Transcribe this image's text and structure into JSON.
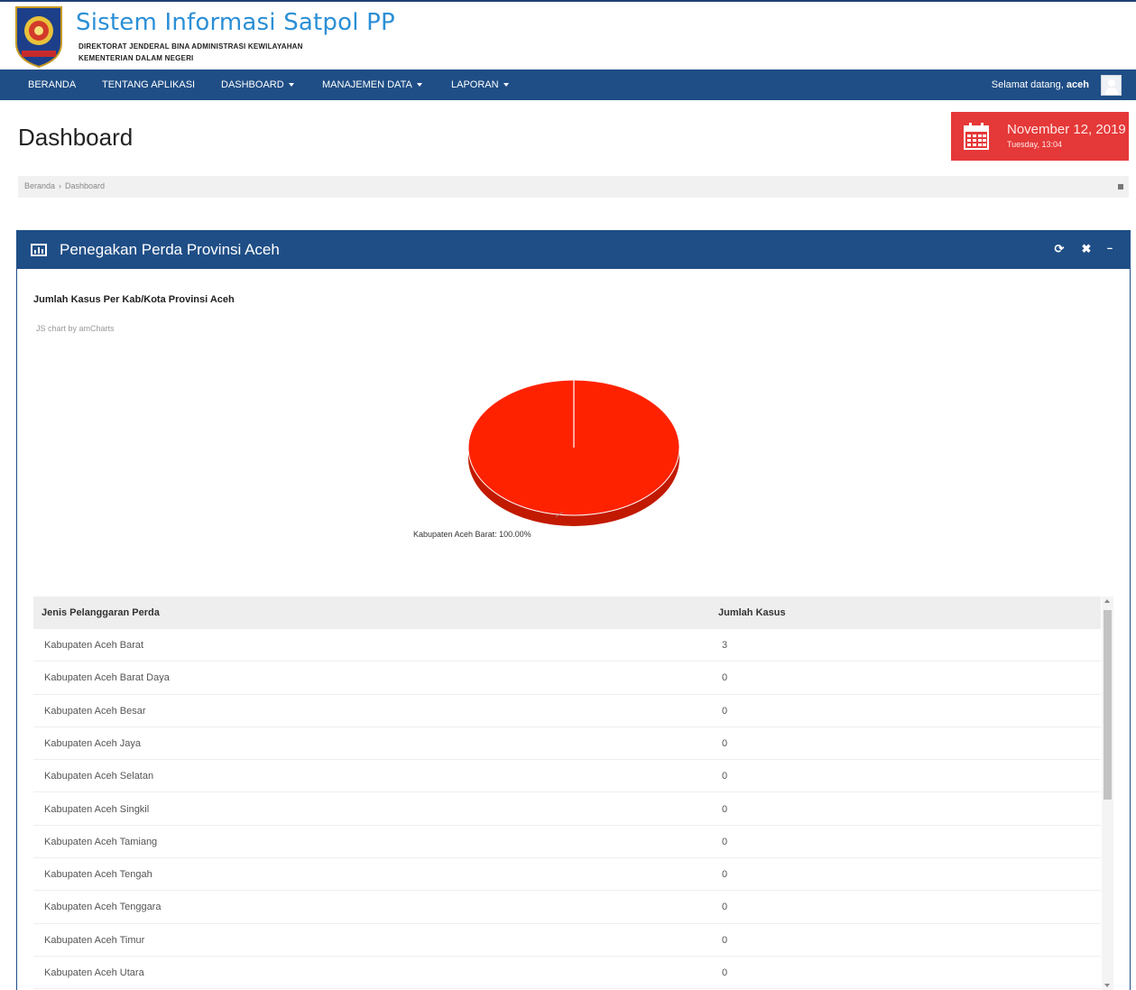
{
  "header": {
    "title": "Sistem Informasi Satpol PP",
    "subtitle_line1": "DIREKTORAT JENDERAL BINA ADMINISTRASI KEWILAYAHAN",
    "subtitle_line2": "KEMENTERIAN DALAM NEGERI"
  },
  "nav": {
    "items": [
      {
        "label": "BERANDA",
        "dropdown": false
      },
      {
        "label": "TENTANG APLIKASI",
        "dropdown": false
      },
      {
        "label": "DASHBOARD",
        "dropdown": true
      },
      {
        "label": "MANAJEMEN DATA",
        "dropdown": true
      },
      {
        "label": "LAPORAN",
        "dropdown": true
      }
    ],
    "welcome_prefix": "Selamat datang,",
    "welcome_user": "aceh"
  },
  "page": {
    "title": "Dashboard"
  },
  "date_widget": {
    "date": "November 12, 2019",
    "time": "Tuesday, 13:04",
    "icon": "calendar-icon",
    "color": "#e53838"
  },
  "breadcrumb": {
    "items": [
      "Beranda",
      "Dashboard"
    ],
    "separator": "›"
  },
  "portlet": {
    "title": "Penegakan Perda Provinsi Aceh",
    "color": "#1f4e86",
    "tools": [
      "reload-icon",
      "close-icon",
      "collapse-icon"
    ]
  },
  "chart_data": {
    "type": "pie",
    "title": "Jumlah Kasus Per Kab/Kota Provinsi Aceh",
    "credit": "JS chart by amCharts",
    "slices": [
      {
        "label": "Kabupaten Aceh Barat",
        "value": 3,
        "percent_label": "100.00%",
        "color": "#ff2200"
      }
    ],
    "slice_label": "Kabupaten Aceh Barat: 100.00%",
    "three_d": true
  },
  "table": {
    "headers": [
      "Jenis Pelanggaran Perda",
      "Jumlah Kasus"
    ],
    "rows": [
      [
        "Kabupaten Aceh Barat",
        "3"
      ],
      [
        "Kabupaten Aceh Barat Daya",
        "0"
      ],
      [
        "Kabupaten Aceh Besar",
        "0"
      ],
      [
        "Kabupaten Aceh Jaya",
        "0"
      ],
      [
        "Kabupaten Aceh Selatan",
        "0"
      ],
      [
        "Kabupaten Aceh Singkil",
        "0"
      ],
      [
        "Kabupaten Aceh Tamiang",
        "0"
      ],
      [
        "Kabupaten Aceh Tengah",
        "0"
      ],
      [
        "Kabupaten Aceh Tenggara",
        "0"
      ],
      [
        "Kabupaten Aceh Timur",
        "0"
      ],
      [
        "Kabupaten Aceh Utara",
        "0"
      ]
    ]
  }
}
